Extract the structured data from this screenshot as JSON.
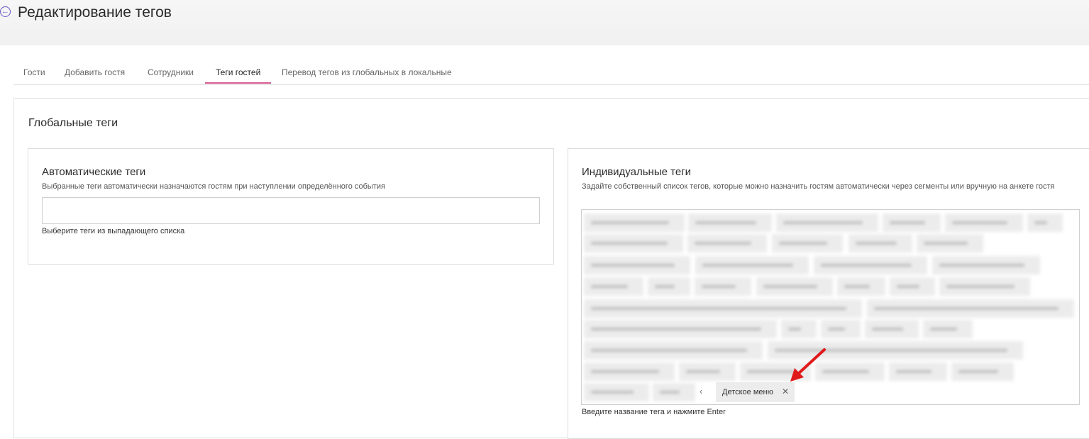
{
  "header": {
    "back_icon": "arrow-left-circle-icon",
    "title": "Редактирование тегов"
  },
  "tabs": [
    {
      "label": "Гости",
      "active": false
    },
    {
      "label": "Добавить гостя",
      "active": false
    },
    {
      "label": "Сотрудники",
      "active": false
    },
    {
      "label": "Теги гостей",
      "active": true
    },
    {
      "label": "Перевод тегов из глобальных в локальные",
      "active": false
    }
  ],
  "global_tags": {
    "title": "Глобальные теги",
    "automatic": {
      "title": "Автоматические теги",
      "description": "Выбранные теги автоматически назначаются гостям при наступлении определённого события",
      "input_value": "",
      "hint": "Выберите теги из выпадающего списка"
    },
    "individual": {
      "title": "Индивидуальные теги",
      "description": "Задайте собственный список тегов, которые можно назначить гостям автоматически через сегменты или вручную на анкете гостя",
      "visible_tag": "Детское меню",
      "remove_icon": "close-icon",
      "hint": "Введите название тега и нажмите Enter"
    }
  },
  "colors": {
    "accent": "#d65a8f",
    "back_icon": "#6a55c7",
    "annotation_arrow": "#e0191b"
  }
}
